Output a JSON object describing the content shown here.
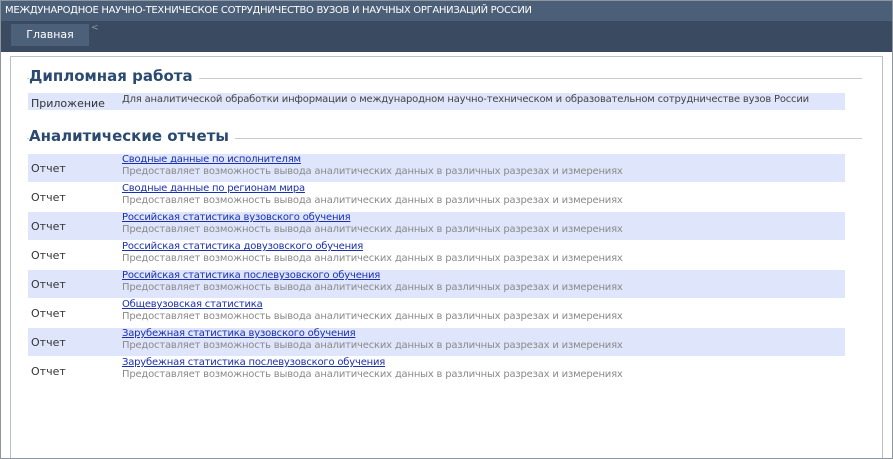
{
  "header": {
    "title": "МЕЖДУНАРОДНОЕ НАУЧНО-ТЕХНИЧЕСКОЕ СОТРУДНИЧЕСТВО ВУЗОВ И НАУЧНЫХ ОРГАНИЗАЦИЙ РОССИИ"
  },
  "nav": {
    "home_label": "Главная",
    "separator": "<"
  },
  "sections": {
    "diploma": {
      "title": "Дипломная работа",
      "app_label": "Приложение",
      "app_description": "Для аналитической обработки информации о международном научно-техническом и образовательном сотрудничестве вузов России"
    },
    "reports": {
      "title": "Аналитические отчеты",
      "items": [
        {
          "type": "Отчет",
          "title": "Сводные данные по исполнителям",
          "description": "Предоставляет возможность вывода аналитических данных в различных разрезах и измерениях"
        },
        {
          "type": "Отчет",
          "title": "Сводные данные по регионам мира",
          "description": "Предоставляет возможность вывода аналитических данных в различных разрезах и измерениях"
        },
        {
          "type": "Отчет",
          "title": "Российская статистика вузовского обучения",
          "description": "Предоставляет возможность вывода аналитических данных в различных разрезах и измерениях"
        },
        {
          "type": "Отчет",
          "title": "Российская статистика довузовского обучения",
          "description": "Предоставляет возможность вывода аналитических данных в различных разрезах и измерениях"
        },
        {
          "type": "Отчет",
          "title": "Российская статистика послевузовского обучения",
          "description": "Предоставляет возможность вывода аналитических данных в различных разрезах и измерениях"
        },
        {
          "type": "Отчет",
          "title": "Общевузовская статистика",
          "description": "Предоставляет возможность вывода аналитических данных в различных разрезах и измерениях"
        },
        {
          "type": "Отчет",
          "title": "Зарубежная статистика вузовского обучения",
          "description": "Предоставляет возможность вывода аналитических данных в различных разрезах и измерениях"
        },
        {
          "type": "Отчет",
          "title": "Зарубежная статистика послевузовского обучения",
          "description": "Предоставляет возможность вывода аналитических данных в различных разрезах и измерениях"
        }
      ]
    }
  },
  "colors": {
    "header_bg": "#4b5f78",
    "nav_bg": "#3a4b61",
    "row_shade": "#dfe6fb",
    "link": "#1a2fb0",
    "section_title": "#2a4a70"
  }
}
